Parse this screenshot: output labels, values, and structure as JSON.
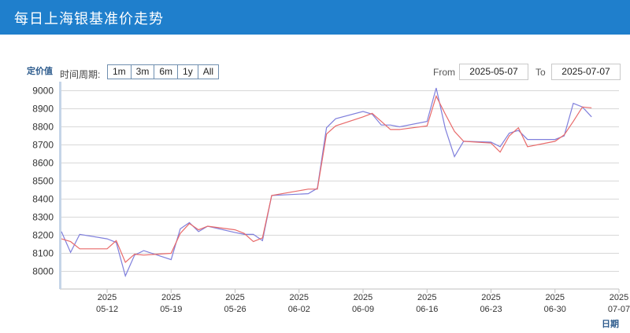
{
  "header": {
    "title": "每日上海银基准价走势"
  },
  "controls": {
    "range_label": "时间周期:",
    "range_buttons": [
      "1m",
      "3m",
      "6m",
      "1y",
      "All"
    ],
    "from_label": "From",
    "from_value": "2025-05-07",
    "to_label": "To",
    "to_value": "2025-07-07"
  },
  "colors": {
    "header": "#1f7fcc",
    "series1": "#7f7fdc",
    "series2": "#e86a6a",
    "grid": "#d8d8d8"
  },
  "chart_data": {
    "type": "line",
    "xlabel": "日期",
    "ylabel": "定价值",
    "ylim": [
      7950,
      9050
    ],
    "yticks": [
      8000,
      8100,
      8200,
      8300,
      8400,
      8500,
      8600,
      8700,
      8800,
      8900,
      9000
    ],
    "x_ticks": [
      {
        "date": "2025-05-12",
        "year": "2025",
        "md": "05-12"
      },
      {
        "date": "2025-05-19",
        "year": "2025",
        "md": "05-19"
      },
      {
        "date": "2025-05-26",
        "year": "2025",
        "md": "05-26"
      },
      {
        "date": "2025-06-02",
        "year": "2025",
        "md": "06-02"
      },
      {
        "date": "2025-06-09",
        "year": "2025",
        "md": "06-09"
      },
      {
        "date": "2025-06-16",
        "year": "2025",
        "md": "06-16"
      },
      {
        "date": "2025-06-23",
        "year": "2025",
        "md": "06-23"
      },
      {
        "date": "2025-06-30",
        "year": "2025",
        "md": "06-30"
      },
      {
        "date": "2025-07-07",
        "year": "2025",
        "md": "07-07"
      }
    ],
    "x": [
      "2025-05-07",
      "2025-05-08",
      "2025-05-09",
      "2025-05-12",
      "2025-05-13",
      "2025-05-14",
      "2025-05-15",
      "2025-05-16",
      "2025-05-19",
      "2025-05-20",
      "2025-05-21",
      "2025-05-22",
      "2025-05-23",
      "2025-05-26",
      "2025-05-27",
      "2025-05-28",
      "2025-05-29",
      "2025-05-30",
      "2025-06-03",
      "2025-06-04",
      "2025-06-05",
      "2025-06-06",
      "2025-06-09",
      "2025-06-10",
      "2025-06-11",
      "2025-06-12",
      "2025-06-13",
      "2025-06-16",
      "2025-06-17",
      "2025-06-18",
      "2025-06-19",
      "2025-06-20",
      "2025-06-23",
      "2025-06-24",
      "2025-06-25",
      "2025-06-26",
      "2025-06-27",
      "2025-06-30",
      "2025-07-01",
      "2025-07-02",
      "2025-07-03",
      "2025-07-04",
      "2025-07-07"
    ],
    "series": [
      {
        "values": [
          8220,
          8105,
          8205,
          8180,
          8160,
          7975,
          8090,
          8115,
          8065,
          8235,
          8270,
          8220,
          8250,
          8215,
          8205,
          8205,
          8170,
          8420,
          8430,
          8460,
          8795,
          8845,
          8885,
          8870,
          8810,
          8810,
          8800,
          8830,
          9015,
          8790,
          8635,
          8720,
          8715,
          8690,
          8765,
          8780,
          8730,
          8730,
          8750,
          8930,
          8910,
          8855
        ]
      },
      {
        "values": [
          8180,
          8165,
          8125,
          8125,
          8170,
          8050,
          8095,
          8090,
          8100,
          8210,
          8265,
          8230,
          8250,
          8230,
          8210,
          8165,
          8185,
          8420,
          8455,
          8455,
          8760,
          8805,
          8855,
          8875,
          8830,
          8785,
          8785,
          8805,
          8970,
          8870,
          8775,
          8720,
          8710,
          8660,
          8750,
          8795,
          8690,
          8720,
          8755,
          8830,
          8910,
          8905
        ]
      }
    ]
  }
}
